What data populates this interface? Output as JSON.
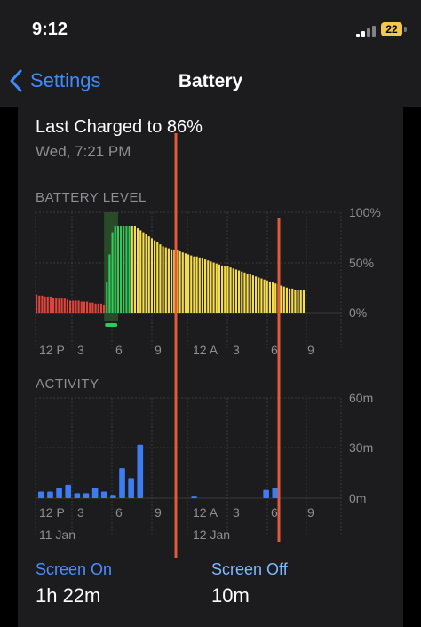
{
  "status": {
    "time": "9:12",
    "battery": "22"
  },
  "nav": {
    "back_label": "Settings",
    "title": "Battery"
  },
  "summary": {
    "last_charged": "Last Charged to 86%",
    "last_time": "Wed, 7:21 PM"
  },
  "battery_level": {
    "title": "BATTERY LEVEL",
    "y_ticks": [
      "100%",
      "50%",
      "0%"
    ],
    "x_ticks": [
      "12 P",
      "3",
      "6",
      "9",
      "12 A",
      "3",
      "6",
      "9"
    ]
  },
  "activity": {
    "title": "ACTIVITY",
    "y_ticks": [
      "60m",
      "30m",
      "0m"
    ],
    "x_ticks": [
      "12 P",
      "3",
      "6",
      "9",
      "12 A",
      "3",
      "6",
      "9"
    ],
    "dates": [
      "11 Jan",
      "12 Jan"
    ]
  },
  "legend": {
    "screen_on_label": "Screen On",
    "screen_on_value": "1h 22m",
    "screen_off_label": "Screen Off",
    "screen_off_value": "10m"
  },
  "colors": {
    "accent": "#3b8cff",
    "low": "#e0443a",
    "charging": "#34c759",
    "yellow": "#f5dc4a",
    "activity": "#3d7cf2",
    "marker": "#e05a3c"
  },
  "chart_data": [
    {
      "type": "bar",
      "title": "BATTERY LEVEL",
      "ylim": [
        0,
        100
      ],
      "y_unit": "%",
      "x_ticks": [
        "12 P",
        "3",
        "6",
        "9",
        "12 A",
        "3",
        "6",
        "9"
      ],
      "segments": [
        {
          "state": "low",
          "values": [
            18,
            17,
            17,
            16,
            16,
            16,
            15,
            15,
            14,
            14,
            14,
            13,
            12,
            12,
            12,
            12,
            11,
            11,
            11,
            10,
            10,
            9,
            9,
            9,
            8
          ]
        },
        {
          "state": "charging",
          "values": [
            30,
            58,
            80,
            86,
            86,
            86,
            86,
            86,
            86
          ]
        },
        {
          "state": "normal",
          "values": [
            86,
            86,
            84,
            82,
            80,
            78,
            76,
            74,
            72,
            70,
            68,
            66,
            65,
            64,
            63,
            62,
            62,
            61,
            60,
            59,
            58,
            57,
            56,
            56,
            55,
            54,
            53,
            52,
            51,
            50,
            49,
            48,
            47,
            46,
            46,
            45,
            44,
            43,
            42,
            41,
            40,
            39,
            38,
            37,
            36,
            35,
            34,
            33,
            32,
            31,
            30,
            29,
            28,
            27,
            26,
            25,
            24,
            24,
            23,
            23,
            23,
            23
          ]
        }
      ]
    },
    {
      "type": "bar",
      "title": "ACTIVITY",
      "ylim": [
        0,
        60
      ],
      "y_unit": "m",
      "x_ticks": [
        "12 P",
        "3",
        "6",
        "9",
        "12 A",
        "3",
        "6",
        "9"
      ],
      "values": [
        4,
        4,
        6,
        8,
        3,
        3,
        6,
        4,
        2,
        18,
        12,
        32,
        0,
        0,
        0,
        0,
        0,
        1,
        0,
        0,
        0,
        0,
        0,
        0,
        0,
        5,
        6,
        0,
        0,
        0
      ]
    }
  ]
}
